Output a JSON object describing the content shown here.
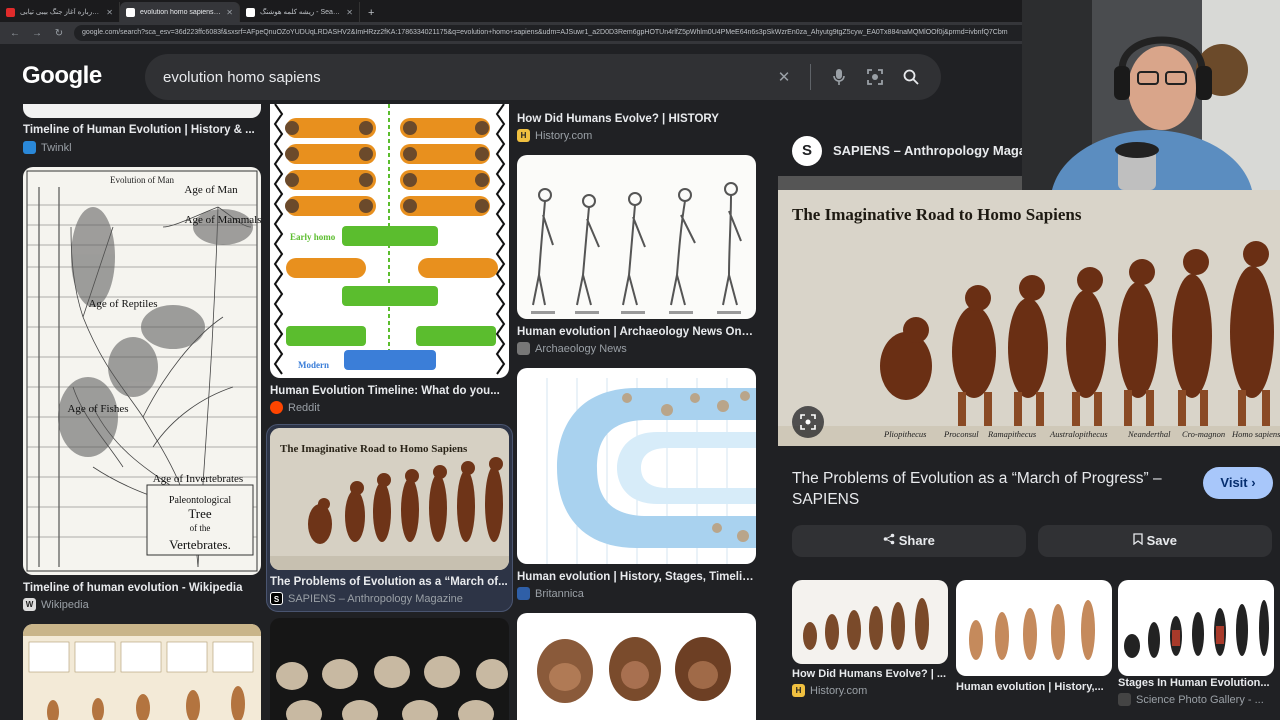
{
  "browser": {
    "tabs": [
      {
        "title": "آموزه درباره آغاز جنگ بیبی تیابی",
        "active": false
      },
      {
        "title": "evolution homo sapiens - Goo",
        "active": true
      },
      {
        "title": "ریشه کلمه هوشنگ - Search",
        "active": false
      }
    ],
    "new_tab": "+",
    "url": "google.com/search?sca_esv=36d223ffc6083f&sxsrf=AFpeQnuOZoYUDUqLRDASHV2&ImHRzz2fKA:1786334021175&q=evolution+homo+sapiens&udm=AJSuwr1_a2D0D3Rem6gpHOTUn4rlfZ5pWhlm0U4PMeE64n6s3pSkWzrEn0za_Ahyutg9tgZ5cyw_EA0Tx884naMQMlOOf0j&prmd=ivbnfQ7Cbm"
  },
  "google": {
    "logo": "Google",
    "query": "evolution homo sapiens"
  },
  "results": {
    "col1": [
      {
        "title": "Timeline of Human Evolution | History & ...",
        "source": "Twinkl"
      },
      {
        "title": "Timeline of human evolution - Wikipedia",
        "source": "Wikipedia"
      }
    ],
    "col2": [
      {
        "title": "Human Evolution Timeline: What do you...",
        "source": "Reddit"
      },
      {
        "title": "The Problems of Evolution as a “March of...",
        "source": "SAPIENS – Anthropology Magazine"
      }
    ],
    "col3": [
      {
        "title": "How Did Humans Evolve? | HISTORY",
        "source": "History.com"
      },
      {
        "title": "Human evolution | Archaeology News Onlin...",
        "source": "Archaeology News"
      },
      {
        "title": "Human evolution | History, Stages, Timeline...",
        "source": "Britannica"
      }
    ],
    "tree_image": {
      "header": "Evolution of Man",
      "ages": [
        "Age of Man",
        "Age of Mammals",
        "Age of Reptiles",
        "Age of Fishes",
        "Age of Invertebrates"
      ],
      "footer": [
        "Paleontological",
        "Tree",
        "of the",
        "Vertebrates."
      ]
    },
    "timeline_image": {
      "early": "Early homo",
      "modern": "Modern"
    },
    "poster_small": "The Imaginative Road to Homo Sapiens"
  },
  "panel": {
    "logo_letter": "S",
    "site": "SAPIENS – Anthropology Magaz",
    "image_caption": "The Imaginative Road to Homo Sapiens",
    "image_labels": [
      "Pliopithecus",
      "Proconsul",
      "Ramapithecus",
      "Australopithecus",
      "Neanderthal",
      "Cro-magnon",
      "Homo sapiens"
    ],
    "title": "The Problems of Evolution as a “March of Progress” – SAPIENS",
    "visit_label": "Visit",
    "share_label": "Share",
    "save_label": "Save",
    "related": [
      {
        "title": "How Did Humans Evolve? | ...",
        "source": "History.com"
      },
      {
        "title": "Human evolution | History,...",
        "source": ""
      },
      {
        "title": "Stages In Human Evolution...",
        "source": "Science Photo Gallery - ..."
      }
    ]
  },
  "colors": {
    "background": "#202124",
    "search_box": "#303134",
    "visit_button": "#a8c7fa",
    "timeline_orange": "#e8901e",
    "timeline_green": "#5bbd2e",
    "timeline_blue": "#3b7ed8"
  }
}
